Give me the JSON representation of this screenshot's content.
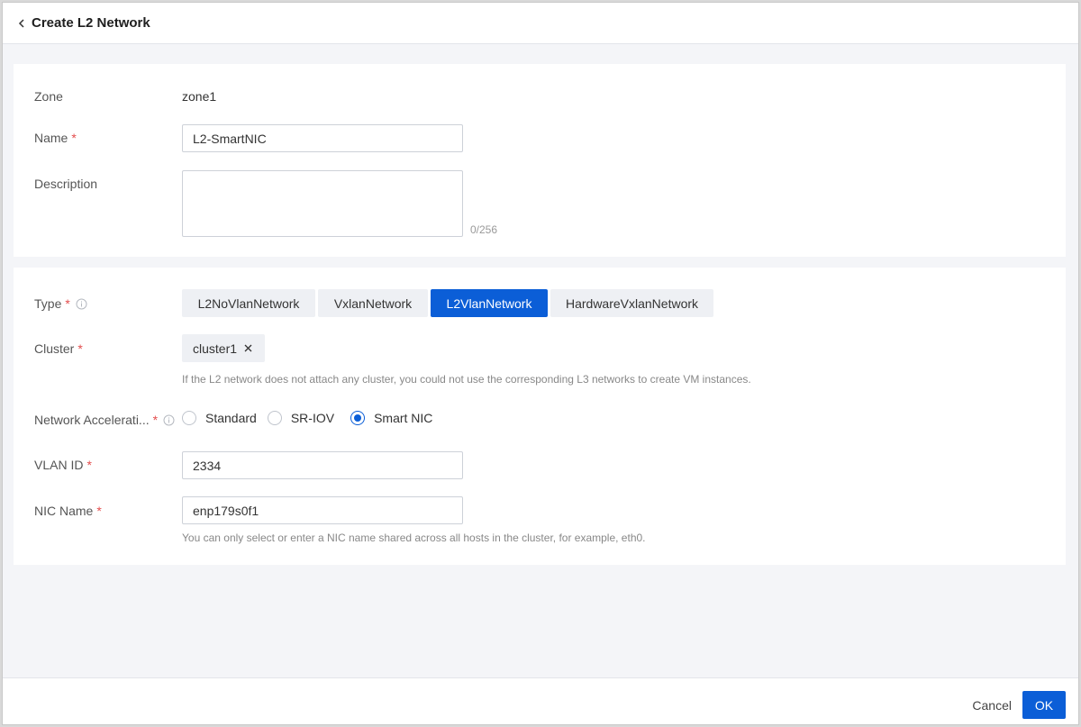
{
  "header": {
    "title": "Create L2 Network"
  },
  "basic": {
    "zone_label": "Zone",
    "zone_value": "zone1",
    "name_label": "Name",
    "name_value": "L2-SmartNIC",
    "description_label": "Description",
    "description_value": "",
    "description_counter": "0/256"
  },
  "network": {
    "type_label": "Type",
    "types": [
      "L2NoVlanNetwork",
      "VxlanNetwork",
      "L2VlanNetwork",
      "HardwareVxlanNetwork"
    ],
    "selected_type": "L2VlanNetwork",
    "cluster_label": "Cluster",
    "cluster_tag": "cluster1",
    "cluster_hint": "If the L2 network does not attach any cluster, you could not use the corresponding L3 networks to create VM instances.",
    "acceleration_label": "Network Accelerati...",
    "acceleration_options": [
      "Standard",
      "SR-IOV",
      "Smart NIC"
    ],
    "acceleration_selected": "Smart NIC",
    "vlan_label": "VLAN ID",
    "vlan_value": "2334",
    "nic_label": "NIC Name",
    "nic_value": "enp179s0f1",
    "nic_hint": "You can only select or enter a NIC name shared across all hosts in the cluster, for example, eth0."
  },
  "footer": {
    "cancel_label": "Cancel",
    "ok_label": "OK"
  },
  "colors": {
    "accent": "#0b5ed7",
    "required": "#e34d4d",
    "page_bg": "#f4f5f8"
  }
}
